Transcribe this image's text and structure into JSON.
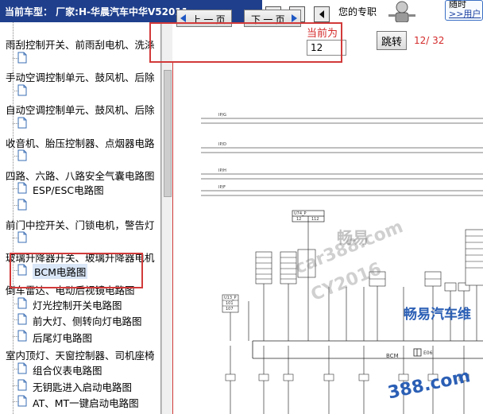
{
  "header": {
    "car_model": "当前车型：  厂家:H-华晨汽车中华V52011",
    "expert_text": "您的专职",
    "corner_top": "随时",
    "corner_link": ">>用户"
  },
  "tree": {
    "items": [
      {
        "type": "cat",
        "label": "雨刮控制开关、前雨刮电机、洗涤"
      },
      {
        "type": "doc",
        "label": ""
      },
      {
        "type": "cat",
        "label": "手动空调控制单元、鼓风机、后除"
      },
      {
        "type": "doc",
        "label": ""
      },
      {
        "type": "cat",
        "label": "自动空调控制单元、鼓风机、后除"
      },
      {
        "type": "doc",
        "label": ""
      },
      {
        "type": "cat",
        "label": "收音机、胎压控制器、点烟器电路"
      },
      {
        "type": "doc",
        "label": ""
      },
      {
        "type": "cat",
        "label": "四路、六路、八路安全气囊电路图"
      },
      {
        "type": "doc",
        "label": "ESP/ESC电路图"
      },
      {
        "type": "doc",
        "label": ""
      },
      {
        "type": "cat",
        "label": "前门中控开关、门锁电机，警告灯"
      },
      {
        "type": "doc",
        "label": ""
      },
      {
        "type": "cat",
        "label": "玻璃升降器开关、玻璃升降器电机"
      },
      {
        "type": "doc",
        "label": "BCM电路图",
        "selected": true
      },
      {
        "type": "cat",
        "label": "倒车雷达、电动后视镜电路图"
      },
      {
        "type": "doc",
        "label": "灯光控制开关电路图"
      },
      {
        "type": "doc",
        "label": "前大灯、侧转向灯电路图"
      },
      {
        "type": "doc",
        "label": "后尾灯电路图"
      },
      {
        "type": "cat",
        "label": "室内顶灯、天窗控制器、司机座椅"
      },
      {
        "type": "doc",
        "label": "组合仪表电路图"
      },
      {
        "type": "doc",
        "label": "无钥匙进入启动电路图"
      },
      {
        "type": "doc",
        "label": "AT、MT一键启动电路图"
      }
    ]
  },
  "toolbar": {
    "prev_label": "上 一 页",
    "next_label": "下 一 页",
    "current_label": "当前为",
    "current_value": "12",
    "jump_label": "跳转",
    "page_count": "12/ 32"
  },
  "diagram": {
    "watermark_1": "畅易",
    "watermark_2": "car388.com",
    "watermark_3": "CY2016",
    "watermark_4": "畅易汽车维",
    "watermark_5": "388.com",
    "wire_labels": [
      "IP/G",
      "IP/D",
      "IP/H",
      "IP/F"
    ],
    "bcm_label": "BCM",
    "connector_label": "E06",
    "top_connector": [
      "U74_P",
      "12",
      "112"
    ],
    "left_connector": [
      "U13_P",
      "101",
      "107"
    ]
  },
  "colors": {
    "header_bg": "#1f3f8c",
    "highlight_red": "#d23a3a",
    "page_text_red": "#d42b2b",
    "watermark_blue": "#2b5fb5"
  }
}
